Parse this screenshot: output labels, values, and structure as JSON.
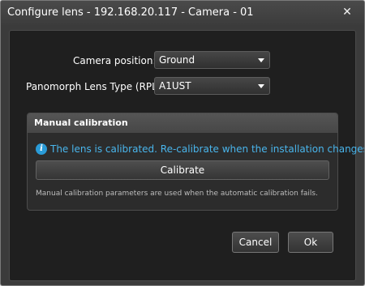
{
  "window": {
    "title": "Configure lens - 192.168.20.117 - Camera - 01",
    "close_glyph": "✕"
  },
  "form": {
    "camera_position": {
      "label": "Camera position:",
      "value": "Ground"
    },
    "lens_type": {
      "label": "Panomorph Lens Type (RPL):",
      "value": "A1UST"
    }
  },
  "manual_calibration": {
    "title": "Manual calibration",
    "info_icon_glyph": "i",
    "status_text": "The lens is calibrated. Re-calibrate when the installation changes.",
    "calibrate_label": "Calibrate",
    "help_text": "Manual calibration parameters are used when the automatic calibration fails."
  },
  "footer": {
    "cancel_label": "Cancel",
    "ok_label": "Ok"
  },
  "colors": {
    "info_accent": "#49b5ec",
    "info_icon_bg": "#2a9bd7",
    "panel_bg": "#1f1f1f",
    "window_bg": "#3b3b3b"
  }
}
